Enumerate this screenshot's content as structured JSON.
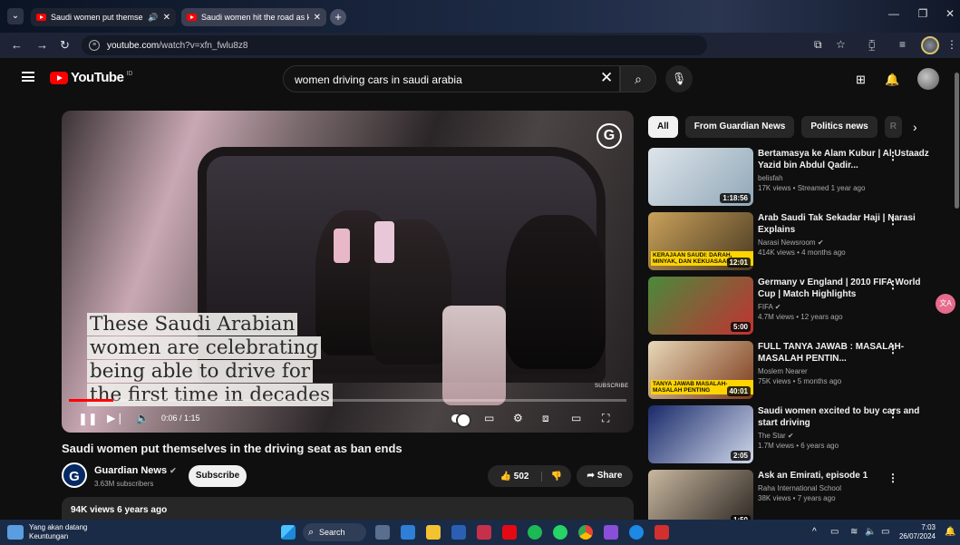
{
  "browser": {
    "tabs": [
      {
        "title": "Saudi women put themselv",
        "audio": "🔊",
        "close": "✕"
      },
      {
        "title": "Saudi women hit the road as ki",
        "close": "✕"
      }
    ],
    "new_tab": "+",
    "address": {
      "domain": "youtube.com",
      "path": "/watch?v=xfn_fwlu8z8"
    }
  },
  "youtube": {
    "logo_text": "YouTube",
    "country_code": "ID",
    "search": {
      "query": "women driving cars in saudi arabia"
    }
  },
  "player": {
    "caption_lines": [
      "These Saudi Arabian",
      "women are celebrating",
      "being able to drive for",
      "the first time in decades"
    ],
    "watermark": "SUBSCRIBE",
    "brand_glyph": "G",
    "time_current": "0:06",
    "time_total": "1:15",
    "time_display": "0:06 / 1:15",
    "progress": 0.08
  },
  "video": {
    "title": "Saudi women put themselves in the driving seat as ban ends",
    "channel": {
      "name": "Guardian News",
      "logo_glyph": "G",
      "subscribers": "3.63M subscribers"
    },
    "subscribe_label": "Subscribe",
    "likes": "502",
    "share_label": "Share",
    "description_stats": "94K views  6 years ago"
  },
  "chips": [
    "All",
    "From Guardian News",
    "Politics news",
    "R"
  ],
  "recommendations": [
    {
      "title": "Bertamasya ke Alam Kubur | Al Ustaadz Yazid bin Abdul Qadir...",
      "channel": "belisfah",
      "verified": false,
      "meta": "17K views • Streamed 1 year ago",
      "duration": "1:18:56",
      "thumb_colors": [
        "#dfe5ea",
        "#8fa7b8"
      ]
    },
    {
      "title": "Arab Saudi Tak Sekadar Haji | Narasi Explains",
      "channel": "Narasi Newsroom",
      "verified": true,
      "meta": "414K views • 4 months ago",
      "duration": "12:01",
      "thumb_colors": [
        "#c9a15a",
        "#4a3a22"
      ],
      "thumb_text": "KERAJAAN SAUDI: DARAH, MINYAK, DAN KEKUASAAN"
    },
    {
      "title": "Germany v England | 2010 FIFA World Cup | Match Highlights",
      "channel": "FIFA",
      "verified": true,
      "meta": "4.7M views • 12 years ago",
      "duration": "5:00",
      "thumb_colors": [
        "#4a8a3c",
        "#c23232"
      ]
    },
    {
      "title": "FULL TANYA JAWAB : MASALAH-MASALAH PENTIN...",
      "channel": "Moslem Nearer",
      "verified": false,
      "meta": "75K views • 5 months ago",
      "duration": "40:01",
      "thumb_colors": [
        "#e8d8b8",
        "#7b3b1b"
      ],
      "thumb_text": "TANYA JAWAB MASALAH-MASALAH PENTING"
    },
    {
      "title": "Saudi women excited to buy cars and start driving",
      "channel": "The Star",
      "verified": true,
      "meta": "1.7M views • 6 years ago",
      "duration": "2:05",
      "thumb_colors": [
        "#1a2a6a",
        "#cfd8ea"
      ]
    },
    {
      "title": "Ask an Emirati, episode 1",
      "channel": "Raha International School",
      "verified": false,
      "meta": "38K views • 7 years ago",
      "duration": "1:50",
      "thumb_colors": [
        "#c9b8a0",
        "#2a2420"
      ]
    }
  ],
  "side_badge": "文A",
  "taskbar": {
    "weather_line1": "Yang akan datang",
    "weather_line2": "Keuntungan",
    "search_label": "Search",
    "clock_time": "7:03",
    "clock_date": "26/07/2024"
  },
  "icons": {
    "accent": "#ff0000",
    "chrome_bg": "#1e2436"
  }
}
